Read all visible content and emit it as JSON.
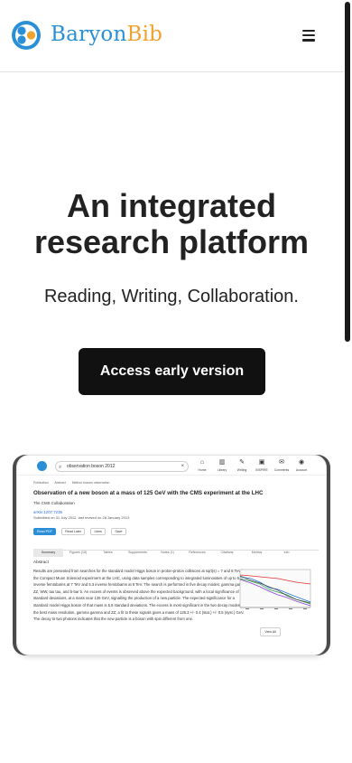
{
  "header": {
    "brand_prefix": "Baryon",
    "brand_suffix": "Bib",
    "menu_icon": "hamburger-menu-icon",
    "colors": {
      "brand_blue": "#2a8fd6",
      "brand_orange": "#f0a22e"
    }
  },
  "hero": {
    "title": "An integrated research platform",
    "subtitle": "Reading, Writing, Collaboration.",
    "cta_label": "Access early version"
  },
  "preview": {
    "search_value": "observation boson 2012",
    "nav": [
      {
        "icon": "home-icon",
        "label": "Home"
      },
      {
        "icon": "library-icon",
        "label": "Library"
      },
      {
        "icon": "writing-icon",
        "label": "Writing"
      },
      {
        "icon": "inspire-icon",
        "label": "INSPIRE"
      },
      {
        "icon": "comments-icon",
        "label": "Comments"
      },
      {
        "icon": "account-icon",
        "label": "Account"
      }
    ],
    "crumbs": [
      "Publication",
      "Abstract",
      "Method bosons observation"
    ],
    "paper_title": "Observation of a new boson at a mass of 125 GeV with the CMS experiment at the LHC",
    "author": "The CMS Collaboration",
    "arxiv": "arXiv:1207.7235",
    "dates": "Submitted on 31 July 2012, last revised on 28 January 2013",
    "buttons": [
      "Read PDF",
      "Read Later",
      "Likes",
      "Save"
    ],
    "tabs": [
      "Summary",
      "Figures (15)",
      "Tables",
      "Supplements",
      "Notes (1)",
      "References",
      "Citations",
      "Metrics",
      "Info"
    ],
    "abstract_heading": "Abstract",
    "abstract": "Results are presented from searches for the standard model Higgs boson in proton-proton collisions at sqrt(s) = 7 and 8 TeV in the Compact Muon Solenoid experiment at the LHC, using data samples corresponding to integrated luminosities of up to 5.1 inverse femtobarns at 7 TeV and 5.3 inverse femtobarns at 8 TeV. The search is performed in five decay modes: gamma gamma, ZZ, WW, tau tau, and b-bar b. An excess of events is observed above the expected background, with a local significance of 5.0 standard deviations, at a mass near 125 GeV, signalling the production of a new particle. The expected significance for a standard model Higgs boson of that mass is 5.8 standard deviations. The excess is most significant in the two decay modes with the best mass resolution, gamma gamma and ZZ; a fit to these signals gives a mass of 125.3 +/- 0.4 (stat.) +/- 0.5 (syst.) GeV. The decay to two photons indicates that the new particle is a boson with spin different from one.",
    "view_all_label": "View All"
  }
}
